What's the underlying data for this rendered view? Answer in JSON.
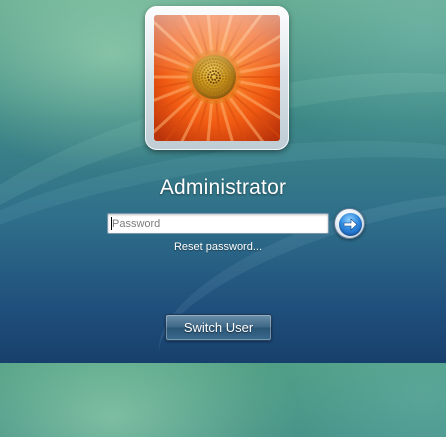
{
  "user": {
    "name": "Administrator",
    "tile_image": "orange-gerbera-flower"
  },
  "password": {
    "placeholder": "Password",
    "value": ""
  },
  "go_button": {
    "icon": "arrow-right-icon",
    "accent": "#2e88de"
  },
  "reset_link": {
    "label": "Reset password..."
  },
  "switch_user": {
    "label": "Switch User"
  },
  "colors": {
    "background_top": "#4e9d83",
    "background_bottom": "#183f6c",
    "flower_orange": "#ff7a1e",
    "flower_center": "#d4a21a"
  }
}
